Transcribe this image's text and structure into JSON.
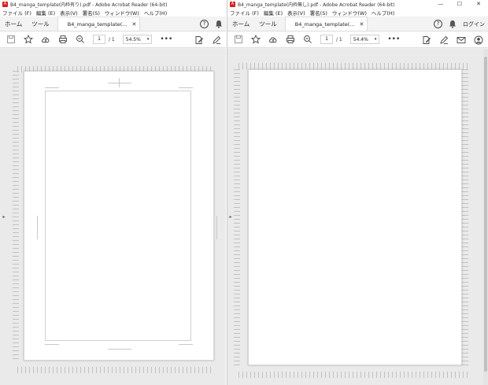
{
  "left_window": {
    "title": "B4_manga_template(内枠有り).pdf - Adobe Acrobat Reader (64-bit)",
    "menu": [
      "ファイル (F)",
      "編集 (E)",
      "表示(V)",
      "署名(S)",
      "ウィンドウ(W)",
      "ヘルプ(H)"
    ],
    "nav_tabs": [
      "ホーム",
      "ツール"
    ],
    "doc_tab": "B4_manga_template(...",
    "page_current": "1",
    "page_total": "/ 1",
    "zoom": "54.5%"
  },
  "right_window": {
    "title": "B4_manga_template(内枠無し).pdf - Adobe Acrobat Reader (64-bit)",
    "menu": [
      "ファイル (F)",
      "編集 (E)",
      "表示(V)",
      "署名(S)",
      "ウィンドウ(W)",
      "ヘルプ(H)"
    ],
    "nav_tabs": [
      "ホーム",
      "ツール"
    ],
    "doc_tab": "B4_manga_template(...",
    "page_current": "1",
    "page_total": "/ 1",
    "zoom": "54.4%",
    "login": "ログイン"
  },
  "glyphs": {
    "close": "✕",
    "caret": "▾",
    "more": "•••",
    "help": "?",
    "side_arrow": "▸",
    "minimize": "—",
    "maximize": "☐",
    "window_close": "✕",
    "app_icon": "A"
  },
  "colors": {
    "app_red": "#d6201f",
    "page": "#ffffff",
    "workspace": "#eaeaea"
  },
  "icons": [
    "save-icon",
    "star-icon",
    "cloud-upload-icon",
    "print-icon",
    "zoom-out-icon",
    "edit-pdf-icon",
    "sign-icon",
    "mail-icon",
    "account-icon",
    "help-icon",
    "bell-icon"
  ]
}
